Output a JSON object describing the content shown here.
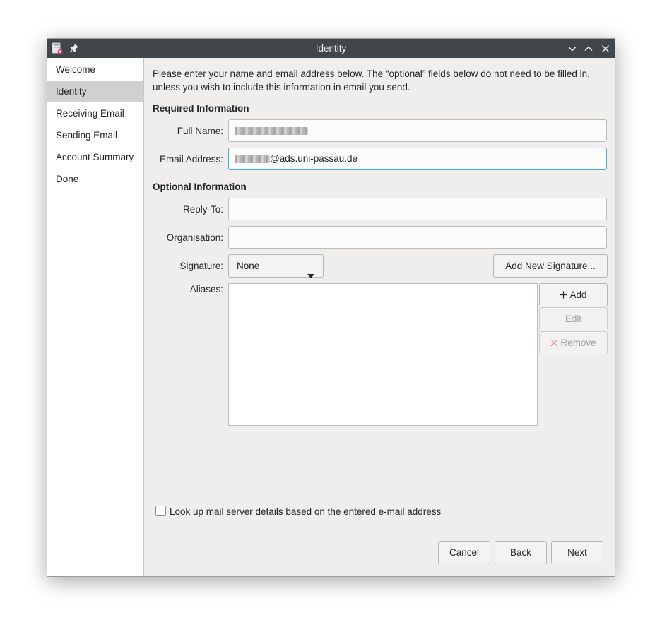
{
  "window": {
    "title": "Identity"
  },
  "sidebar": {
    "items": [
      {
        "label": "Welcome"
      },
      {
        "label": "Identity"
      },
      {
        "label": "Receiving Email"
      },
      {
        "label": "Sending Email"
      },
      {
        "label": "Account Summary"
      },
      {
        "label": "Done"
      }
    ],
    "active_index": 1
  },
  "form": {
    "intro": "Please enter your name and email address below. The “optional” fields below do not need to be filled in, unless you wish to include this information in email you send.",
    "required_heading": "Required Information",
    "full_name_label": "Full Name:",
    "email_label": "Email Address:",
    "email_visible_suffix": "@ads.uni-passau.de",
    "optional_heading": "Optional Information",
    "reply_to_label": "Reply-To:",
    "reply_to_value": "",
    "organisation_label": "Organisation:",
    "organisation_value": "",
    "signature_label": "Signature:",
    "signature_value": "None",
    "add_signature_label": "Add New Signature...",
    "aliases_label": "Aliases:",
    "add_label": "Add",
    "edit_label": "Edit",
    "remove_label": "Remove",
    "lookup_label": "Look up mail server details based on the entered e-mail address",
    "lookup_checked": false
  },
  "footer": {
    "cancel_label": "Cancel",
    "back_label": "Back",
    "next_label": "Next"
  },
  "colors": {
    "titlebar": "#41464b",
    "focus_accent": "#3daee9",
    "sidebar_selected": "#d0d0d0"
  }
}
